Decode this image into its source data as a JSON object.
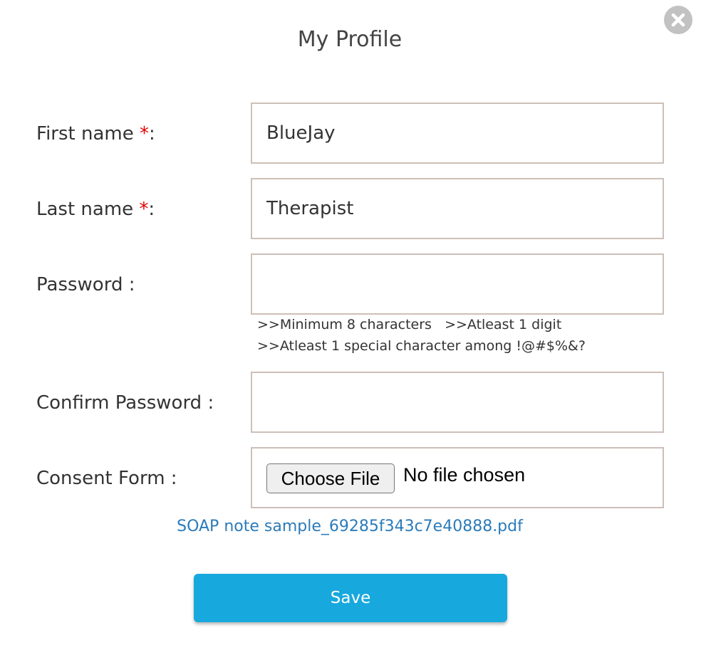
{
  "modal": {
    "title": "My Profile",
    "close_icon": "close-x-circle-icon"
  },
  "form": {
    "first_name": {
      "label": "First name ",
      "required_mark": "*",
      "suffix": ":",
      "value": "BlueJay"
    },
    "last_name": {
      "label": "Last name ",
      "required_mark": "*",
      "suffix": ":",
      "value": "Therapist"
    },
    "password": {
      "label": "Password :",
      "value": ""
    },
    "password_hints": {
      "line1_a": ">>Minimum 8 characters",
      "line1_b": ">>Atleast 1 digit",
      "line2": ">>Atleast 1 special character among !@#$%&?"
    },
    "confirm_password": {
      "label": "Confirm Password :",
      "value": ""
    },
    "consent_form": {
      "label": "Consent Form :",
      "button_label": "Choose File",
      "status": "No file chosen",
      "existing_file": "SOAP note sample_69285f343c7e40888.pdf"
    }
  },
  "actions": {
    "save_label": "Save"
  },
  "colors": {
    "required": "#e60000",
    "link": "#2b7bb9",
    "save_button": "#17a8de",
    "input_border": "#cdbfb8",
    "close_button": "#c2c2c2"
  }
}
